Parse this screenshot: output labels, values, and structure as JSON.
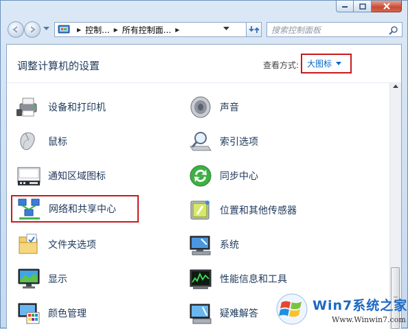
{
  "nav": {
    "breadcrumbs": [
      "控制...",
      "所有控制面..."
    ],
    "search_placeholder": "搜索控制面板"
  },
  "header": {
    "title": "调整计算机的设置",
    "view_label": "查看方式:",
    "view_value": "大图标"
  },
  "items_left": [
    {
      "label": "设备和打印机",
      "icon": "printer-icon"
    },
    {
      "label": "鼠标",
      "icon": "mouse-icon"
    },
    {
      "label": "通知区域图标",
      "icon": "taskbar-icon"
    },
    {
      "label": "网络和共享中心",
      "icon": "network-icon"
    },
    {
      "label": "文件夹选项",
      "icon": "folder-icon"
    },
    {
      "label": "显示",
      "icon": "monitor-icon"
    },
    {
      "label": "颜色管理",
      "icon": "color-management-icon"
    }
  ],
  "items_right": [
    {
      "label": "声音",
      "icon": "speaker-icon"
    },
    {
      "label": "索引选项",
      "icon": "indexing-icon"
    },
    {
      "label": "同步中心",
      "icon": "sync-icon"
    },
    {
      "label": "位置和其他传感器",
      "icon": "sensor-icon"
    },
    {
      "label": "系统",
      "icon": "system-icon"
    },
    {
      "label": "性能信息和工具",
      "icon": "performance-icon"
    },
    {
      "label": "疑难解答",
      "icon": "troubleshoot-icon"
    }
  ],
  "watermark": {
    "title": "Win7系统之家",
    "url": "Www.Winwin7.com"
  },
  "colors": {
    "highlight_box": "#c8181c",
    "link": "#0066cc",
    "title_text": "#1e395b"
  }
}
